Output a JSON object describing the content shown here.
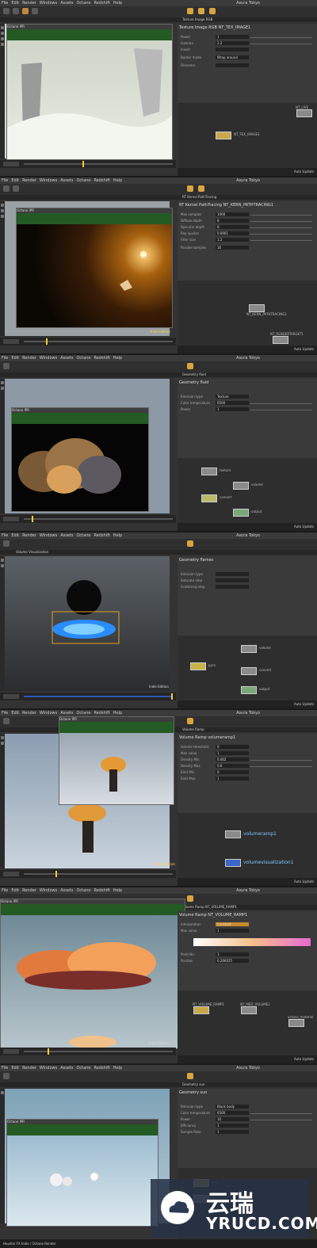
{
  "menu": [
    "File",
    "Edit",
    "Render",
    "Windows",
    "Assets",
    "Octane",
    "Redshift",
    "Help"
  ],
  "brand": "Asura Tokyo",
  "ipr_title": "Octane IPR",
  "indie_label": "Indie Edition",
  "auto_update": "Auto Update",
  "screens": [
    {
      "tab": "Texture Image RGB",
      "param_title": "Texture Image RGB  NT_TEX_IMAGE1",
      "params": [
        {
          "label": "Power",
          "value": "1"
        },
        {
          "label": "Gamma",
          "value": "2.2"
        },
        {
          "label": "Invert",
          "value": ""
        },
        {
          "label": "Border mode",
          "value": "Wrap around"
        },
        {
          "label": "Filename",
          "value": ""
        }
      ],
      "nodes": [
        {
          "label": "NT_TEX_IMAGE1"
        },
        {
          "label": "NT_LIVE"
        }
      ],
      "frame": "1"
    },
    {
      "tab": "RT Kernel PathTracing",
      "param_title": "RT Kernel PathTracing  NT_KERN_PATHTRACING1",
      "params": [
        {
          "label": "Max samples",
          "value": "1000"
        },
        {
          "label": "Diffuse depth",
          "value": "8"
        },
        {
          "label": "Specular depth",
          "value": "8"
        },
        {
          "label": "Ray epsilon",
          "value": "0.0001"
        },
        {
          "label": "Filter size",
          "value": "1.2"
        },
        {
          "label": "Parallel samples",
          "value": "16"
        }
      ],
      "nodes": [
        {
          "label": "NT_KERN_PATHTRACING1"
        },
        {
          "label": "NT_RENDERTARGET1"
        }
      ],
      "frame": "1"
    },
    {
      "tab": "Geometry  fluid",
      "param_title": "Geometry  fluid",
      "params": [
        {
          "label": "Emission type",
          "value": "Texture"
        },
        {
          "label": "Color temperature",
          "value": "6500"
        },
        {
          "label": "Power",
          "value": "1"
        }
      ],
      "nodes": [
        {
          "label": "texture"
        },
        {
          "label": "volume"
        },
        {
          "label": "convert"
        },
        {
          "label": "output"
        }
      ],
      "frame": "1"
    },
    {
      "tab": "Volume Visualization",
      "param_title": "Geometry  flames",
      "params": [
        {
          "label": "Emission type",
          "value": ""
        },
        {
          "label": "Saturate step",
          "value": ""
        },
        {
          "label": "Scattering step",
          "value": ""
        }
      ],
      "nodes": [
        {
          "label": "pyro"
        },
        {
          "label": "volume"
        },
        {
          "label": "convert"
        },
        {
          "label": "output"
        }
      ],
      "frame": "48"
    },
    {
      "tab": "Volume Ramp",
      "param_title": "Volume Ramp  volumeramp1",
      "params": [
        {
          "label": "Volume threshold",
          "value": "0"
        },
        {
          "label": "Max value",
          "value": "1"
        },
        {
          "label": "Density Min",
          "value": "0.002"
        },
        {
          "label": "Density Max",
          "value": "0.6"
        },
        {
          "label": "Emit Min",
          "value": "0"
        },
        {
          "label": "Emit Max",
          "value": "1"
        }
      ],
      "nodes": [
        {
          "label": "volumeramp1"
        },
        {
          "label": "volumevisualization1"
        }
      ],
      "frame": "72"
    },
    {
      "tab": "Volume Ramp  NT_VOLUME_RAMP1",
      "param_title": "Volume Ramp  NT_VOLUME_RAMP1",
      "params": [
        {
          "label": "Interpolation",
          "value": "Constant"
        },
        {
          "label": "Max value",
          "value": "1"
        },
        {
          "label": "Point No.",
          "value": "3"
        },
        {
          "label": "Position",
          "value": "0.266025"
        }
      ],
      "nodes": [
        {
          "label": "NT_VOLUME_RAMP1"
        },
        {
          "label": "NT_MED_VOLUME1"
        },
        {
          "label": "octane_material"
        }
      ],
      "frame": "1"
    },
    {
      "tab": "Geometry  sun",
      "param_title": "Geometry  sun",
      "params": [
        {
          "label": "Emission type",
          "value": "Black body"
        },
        {
          "label": "Color temperature",
          "value": "6500"
        },
        {
          "label": "Power",
          "value": "10"
        },
        {
          "label": "Efficiency",
          "value": "1"
        },
        {
          "label": "Sample Rate",
          "value": "1"
        }
      ],
      "nodes": [
        {
          "label": "sun"
        },
        {
          "label": "sky"
        }
      ],
      "frame": "1"
    }
  ],
  "watermark": {
    "cn": "云瑞",
    "en": "YRUCD.COM"
  },
  "footer": "Houdini FX Indie / Octane Render"
}
